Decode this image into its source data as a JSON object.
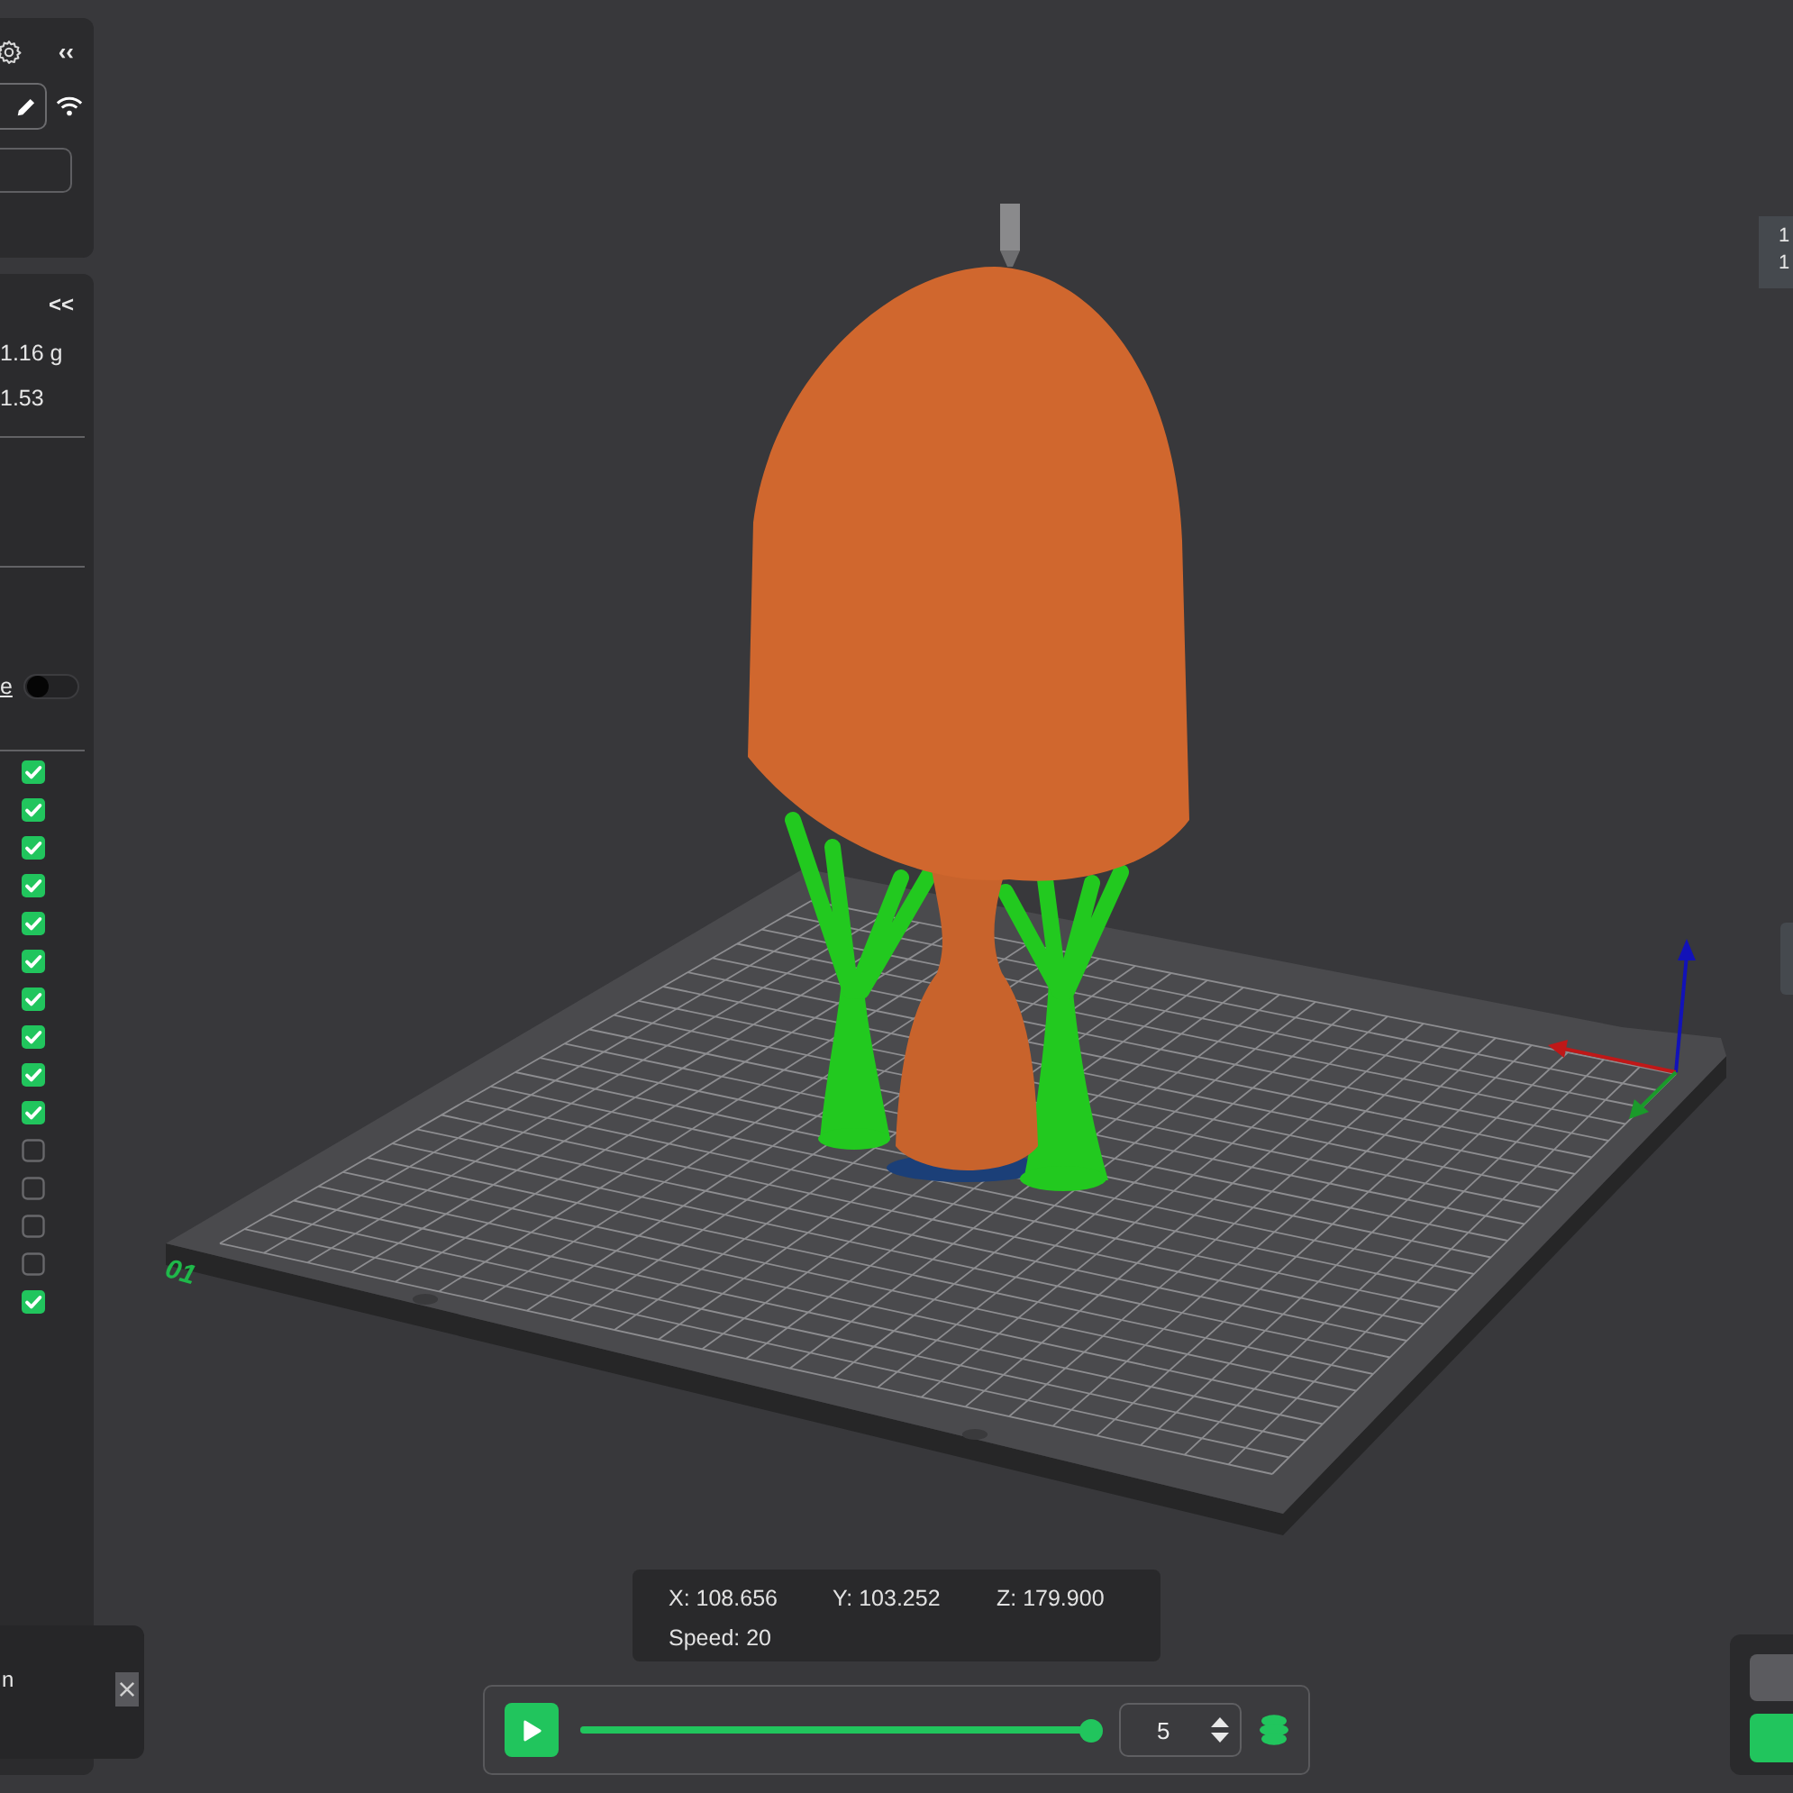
{
  "viewport": {
    "plate_label": "01"
  },
  "printer_card": {
    "collapse": "‹‹"
  },
  "stats_card": {
    "collapse": "<<",
    "weight": "1.16 g",
    "cost": "1.53",
    "toggle": {
      "label": "e",
      "on": false
    }
  },
  "legend": [
    {
      "checked": true
    },
    {
      "checked": true
    },
    {
      "checked": true
    },
    {
      "checked": true
    },
    {
      "checked": true
    },
    {
      "checked": true
    },
    {
      "checked": true
    },
    {
      "checked": true
    },
    {
      "checked": true
    },
    {
      "checked": true
    },
    {
      "checked": false
    },
    {
      "checked": false
    },
    {
      "checked": false
    },
    {
      "checked": false
    },
    {
      "checked": true
    }
  ],
  "notification": {
    "text": "n"
  },
  "position_info": {
    "x": "X: 108.656",
    "y": "Y: 103.252",
    "z": "Z: 179.900",
    "speed": "Speed: 20"
  },
  "playback": {
    "playing": false,
    "level": 1.0,
    "layer": "5"
  },
  "right_panel": {
    "lines": [
      "1",
      "1"
    ]
  }
}
